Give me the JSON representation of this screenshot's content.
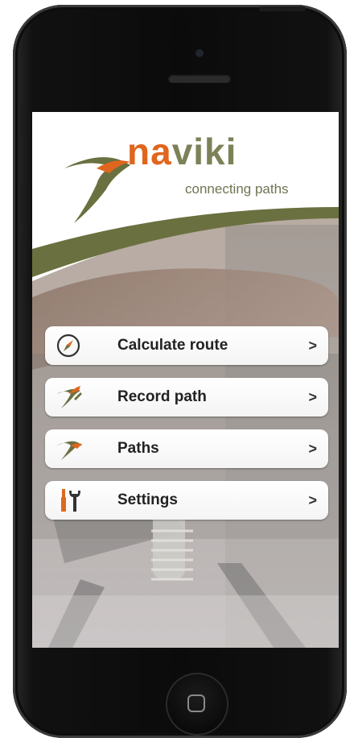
{
  "app": {
    "logo_part1": "na",
    "logo_part2": "viki",
    "tagline": "connecting paths"
  },
  "menu": [
    {
      "label": "Calculate route",
      "icon": "compass-icon"
    },
    {
      "label": "Record path",
      "icon": "record-path-icon"
    },
    {
      "label": "Paths",
      "icon": "paths-icon"
    },
    {
      "label": "Settings",
      "icon": "settings-tools-icon"
    }
  ],
  "chevron": ">",
  "colors": {
    "brand_orange": "#e0661e",
    "brand_olive": "#6f7450",
    "swoosh_green": "#6b7040"
  }
}
